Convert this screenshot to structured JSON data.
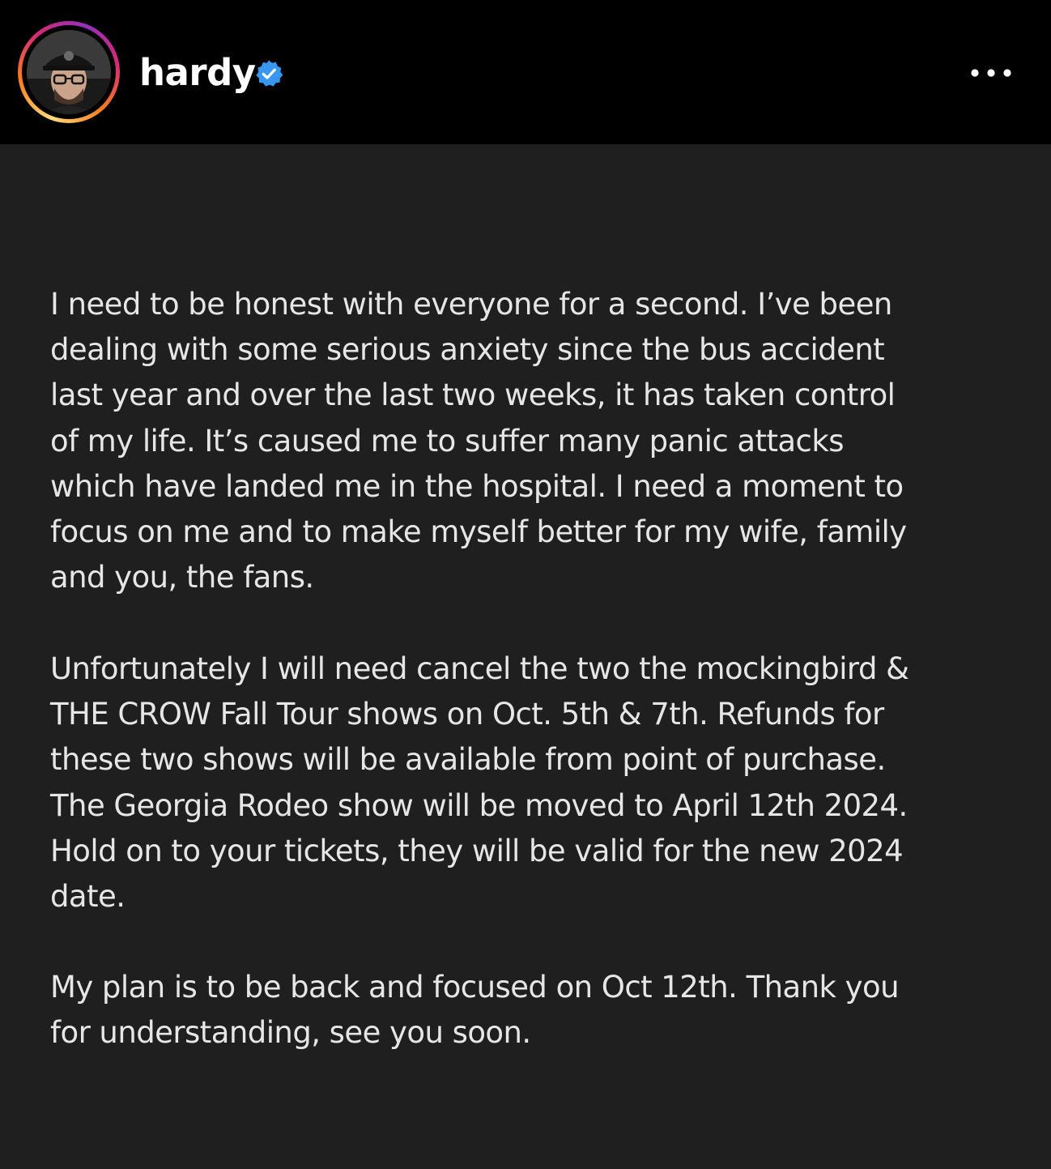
{
  "header": {
    "username": "hardy",
    "verified_icon": "verified-badge-icon",
    "more_icon": "more-options-icon",
    "avatar_icon": "profile-avatar"
  },
  "colors": {
    "header_bg": "#000000",
    "content_bg": "#1f1f1f",
    "text": "#e6e6e6",
    "verified_blue": "#3897f0"
  },
  "post": {
    "paragraph1": "I need to be honest with everyone for a second. I’ve been\ndealing with some serious anxiety since the bus accident\nlast year and over the last two weeks, it has taken control\nof my life. It’s caused me to suffer many panic attacks\nwhich have landed me in the hospital. I need a moment to\nfocus on me and to make myself better for my wife, family\nand you, the fans.",
    "paragraph2": "Unfortunately I will need cancel the two the mockingbird &\nTHE CROW Fall Tour shows on Oct. 5th & 7th. Refunds for\nthese two shows will be available from point of purchase.\nThe Georgia Rodeo show will be moved to April 12th 2024.\nHold on to your tickets, they will be valid for the new 2024\ndate.",
    "paragraph3": "My plan is to be back and focused on Oct 12th. Thank you\nfor understanding, see you soon."
  }
}
